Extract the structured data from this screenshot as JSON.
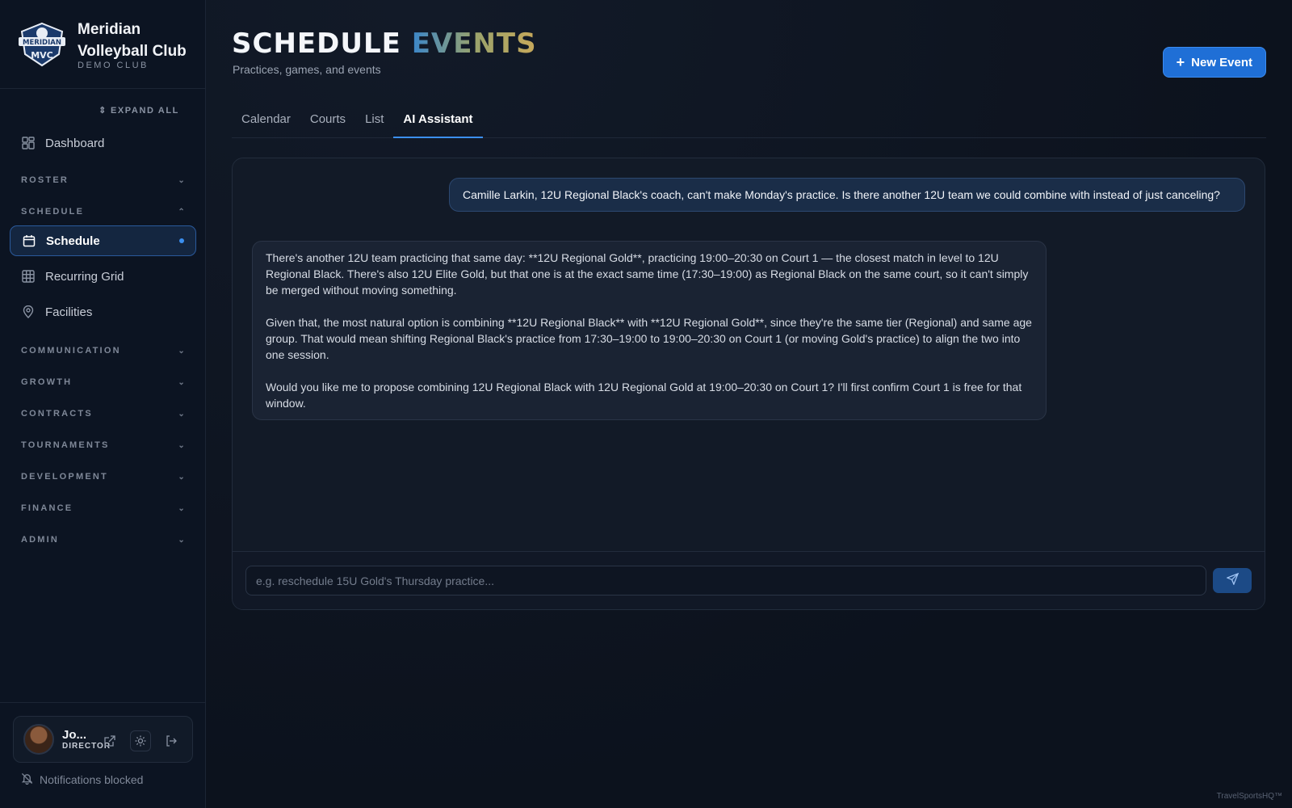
{
  "brand": {
    "name_line1": "Meridian",
    "name_line2": "Volleyball Club",
    "subtitle": "DEMO CLUB",
    "logo_text": "MERIDIAN",
    "logo_mark": "MVC"
  },
  "sidebar": {
    "expand_all": "EXPAND ALL",
    "dashboard": "Dashboard",
    "sections": {
      "roster": "ROSTER",
      "schedule": "SCHEDULE",
      "communication": "COMMUNICATION",
      "growth": "GROWTH",
      "contracts": "CONTRACTS",
      "tournaments": "TOURNAMENTS",
      "development": "DEVELOPMENT",
      "finance": "FINANCE",
      "admin": "ADMIN"
    },
    "schedule_items": [
      "Schedule",
      "Recurring Grid",
      "Facilities"
    ]
  },
  "user": {
    "name": "Jo...",
    "role": "DIRECTOR"
  },
  "notifications": "Notifications blocked",
  "header": {
    "title_main": "SCHEDULE",
    "title_accent": "EVENTS",
    "subtitle": "Practices, games, and events",
    "new_event": "New Event"
  },
  "tabs": [
    "Calendar",
    "Courts",
    "List",
    "AI Assistant"
  ],
  "chat": {
    "user_message": "Camille Larkin, 12U Regional Black's coach, can't make Monday's practice. Is there another 12U team we could combine with instead of just canceling?",
    "assistant_paragraphs": [
      "There's another 12U team practicing that same day: **12U Regional Gold**, practicing 19:00–20:30 on Court 1 — the closest match in level to 12U Regional Black. There's also 12U Elite Gold, but that one is at the exact same time (17:30–19:00) as Regional Black on the same court, so it can't simply be merged without moving something.",
      "Given that, the most natural option is combining **12U Regional Black** with **12U Regional Gold**, since they're the same tier (Regional) and same age group. That would mean shifting Regional Black's practice from 17:30–19:00 to 19:00–20:30 on Court 1 (or moving Gold's practice) to align the two into one session.",
      "Would you like me to propose combining 12U Regional Black with 12U Regional Gold at 19:00–20:30 on Court 1? I'll first confirm Court 1 is free for that window."
    ],
    "placeholder": "e.g. reschedule 15U Gold's Thursday practice..."
  },
  "footer": "TravelSportsHQ™",
  "colors": {
    "accent": "#1f6fd6",
    "active_tab_underline": "#3b8ff0",
    "background": "#0d1320"
  }
}
